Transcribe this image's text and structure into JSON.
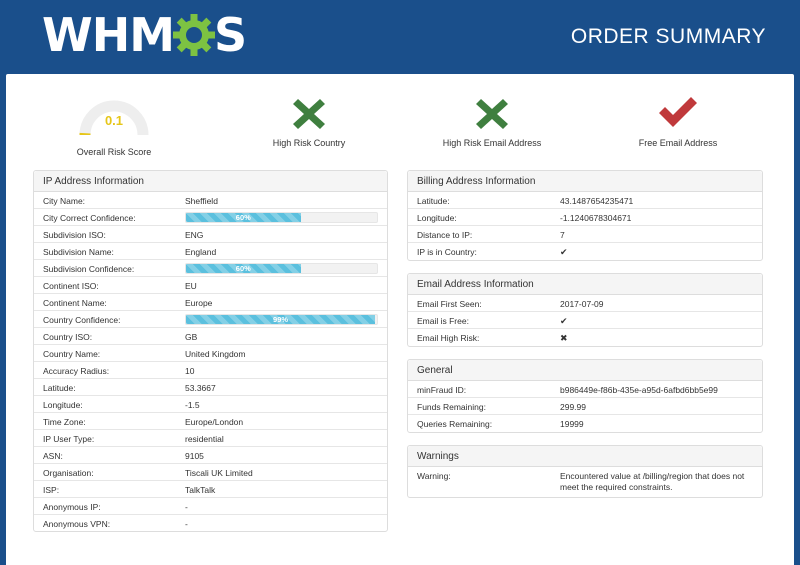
{
  "header": {
    "logo_text": "WHM",
    "logo_text_end": "S",
    "title": "ORDER SUMMARY"
  },
  "scores": [
    {
      "type": "gauge",
      "value": "0.1",
      "label": "Overall Risk Score",
      "fraction": 0.01,
      "color": "#e6c619"
    },
    {
      "type": "cross",
      "label": "High Risk Country",
      "icon": "cross-icon",
      "color": "#3f7f3f"
    },
    {
      "type": "cross",
      "label": "High Risk Email Address",
      "icon": "cross-icon",
      "color": "#3f7f3f"
    },
    {
      "type": "check",
      "label": "Free Email Address",
      "icon": "check-icon",
      "color": "#c0393b"
    }
  ],
  "ip_info": {
    "title": "IP Address Information",
    "rows": [
      {
        "label": "City Name:",
        "value": "Sheffield"
      },
      {
        "label": "City Correct Confidence:",
        "bar": "60%",
        "percent": 60
      },
      {
        "label": "Subdivision ISO:",
        "value": "ENG"
      },
      {
        "label": "Subdivision Name:",
        "value": "England"
      },
      {
        "label": "Subdivision Confidence:",
        "bar": "60%",
        "percent": 60
      },
      {
        "label": "Continent ISO:",
        "value": "EU"
      },
      {
        "label": "Continent Name:",
        "value": "Europe"
      },
      {
        "label": "Country Confidence:",
        "bar": "99%",
        "percent": 99
      },
      {
        "label": "Country ISO:",
        "value": "GB"
      },
      {
        "label": "Country Name:",
        "value": "United Kingdom"
      },
      {
        "label": "Accuracy Radius:",
        "value": "10"
      },
      {
        "label": "Latitude:",
        "value": "53.3667"
      },
      {
        "label": "Longitude:",
        "value": "-1.5"
      },
      {
        "label": "Time Zone:",
        "value": "Europe/London"
      },
      {
        "label": "IP User Type:",
        "value": "residential"
      },
      {
        "label": "ASN:",
        "value": "9105"
      },
      {
        "label": "Organisation:",
        "value": "Tiscali UK Limited"
      },
      {
        "label": "ISP:",
        "value": "TalkTalk"
      },
      {
        "label": "Anonymous IP:",
        "value": "-"
      },
      {
        "label": "Anonymous VPN:",
        "value": "-"
      }
    ]
  },
  "billing": {
    "title": "Billing Address Information",
    "rows": [
      {
        "label": "Latitude:",
        "value": "43.1487654235471"
      },
      {
        "label": "Longitude:",
        "value": "-1.1240678304671"
      },
      {
        "label": "Distance to IP:",
        "value": "7"
      },
      {
        "label": "IP is in Country:",
        "value": "✔"
      }
    ]
  },
  "email": {
    "title": "Email Address Information",
    "rows": [
      {
        "label": "Email First Seen:",
        "value": "2017-07-09"
      },
      {
        "label": "Email is Free:",
        "value": "✔"
      },
      {
        "label": "Email High Risk:",
        "value": "✖"
      }
    ]
  },
  "general": {
    "title": "General",
    "rows": [
      {
        "label": "minFraud ID:",
        "value": "b986449e-f86b-435e-a95d-6afbd6bb5e99"
      },
      {
        "label": "Funds Remaining:",
        "value": "299.99"
      },
      {
        "label": "Queries Remaining:",
        "value": "19999"
      }
    ]
  },
  "warnings": {
    "title": "Warnings",
    "label": "Warning:",
    "value": "Encountered value at /billing/region that does not meet the required constraints."
  },
  "colors": {
    "header_bg": "#1a4f8b",
    "gear": "#7dc242",
    "bar": "#5bc0de"
  }
}
